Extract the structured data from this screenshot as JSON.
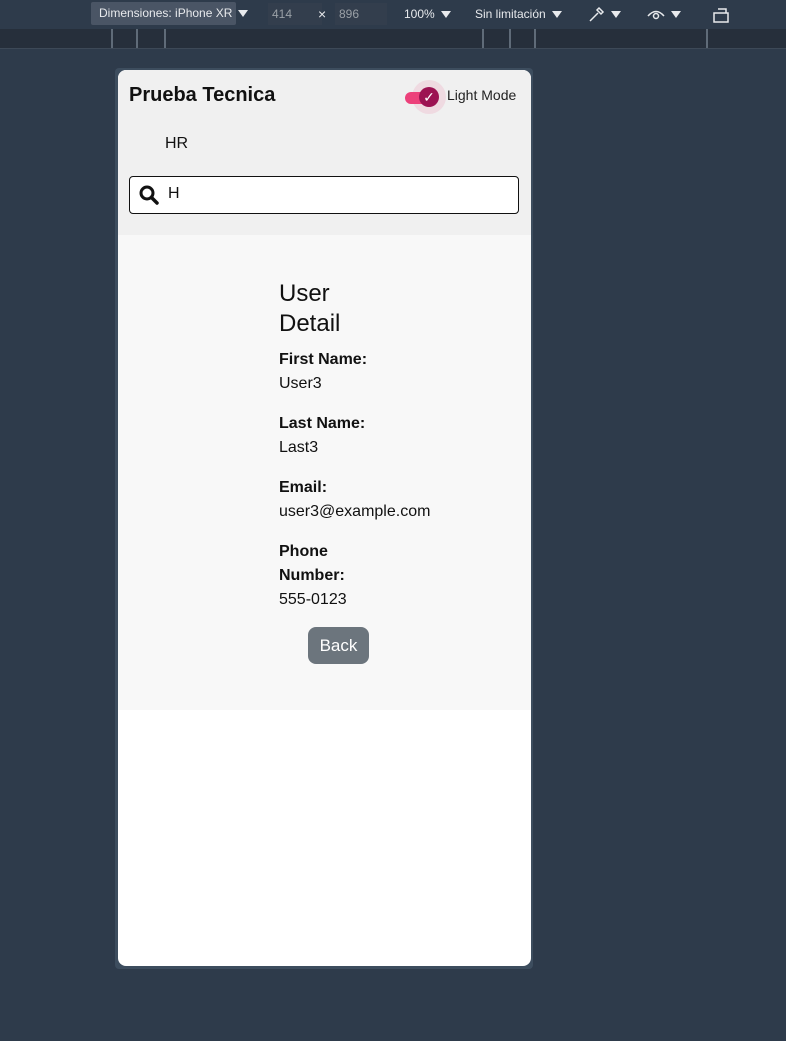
{
  "devtools": {
    "device_label": "Dimensiones: iPhone XR",
    "width": "414",
    "times": "×",
    "height": "896",
    "zoom": "100%",
    "throttle": "Sin limitación"
  },
  "app": {
    "title": "Prueba Tecnica",
    "mode_toggle_label": "Light Mode",
    "mode_toggle_on": true,
    "section": "HR",
    "search": {
      "value": "H",
      "placeholder": ""
    }
  },
  "detail": {
    "heading": "User Detail",
    "fields": [
      {
        "label": "First Name:",
        "value": "User3"
      },
      {
        "label": "Last Name:",
        "value": "Last3"
      },
      {
        "label": "Email:",
        "value": "user3@example.com"
      },
      {
        "label": "Phone Number:",
        "value": "555-0123"
      }
    ],
    "back_label": "Back"
  },
  "colors": {
    "toggle_track": "#ec407a",
    "toggle_knob": "#9c1252",
    "button": "#6c757d",
    "devtools_bg": "#2e3b4b"
  }
}
